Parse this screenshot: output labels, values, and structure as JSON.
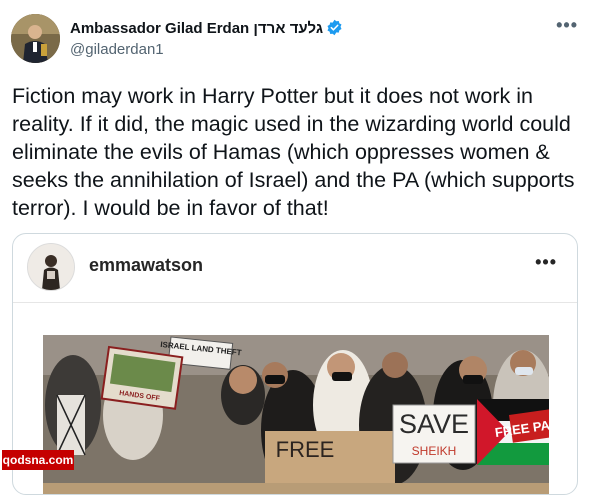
{
  "tweet": {
    "author_name": "Ambassador Gilad Erdan גלעד ארדן",
    "handle": "@giladerdan1",
    "text": "Fiction may work in Harry Potter but it does not work in reality. If it did, the magic used in the wizarding world could eliminate the evils of Hamas (which oppresses women & seeks the annihilation of Israel) and the PA (which supports terror). I would be in favor of that!",
    "more_label": "•••"
  },
  "quoted_post": {
    "username": "emmawatson",
    "more_label": "•••",
    "photo_signs": {
      "israel_sign": "ISRAEL LAND THEFT",
      "hands_off": "HANDS OFF",
      "free": "FREE",
      "save": "SAVE",
      "save_sub": "SHEIKH",
      "free_pales": "FREE PALES"
    }
  },
  "watermark": "qodsna.com",
  "colors": {
    "verified": "#1d9bf0",
    "watermark_bg": "#c50000",
    "text": "#0f1419",
    "secondary": "#536471"
  },
  "icons": [
    "verified-badge-icon",
    "more-options-icon"
  ]
}
